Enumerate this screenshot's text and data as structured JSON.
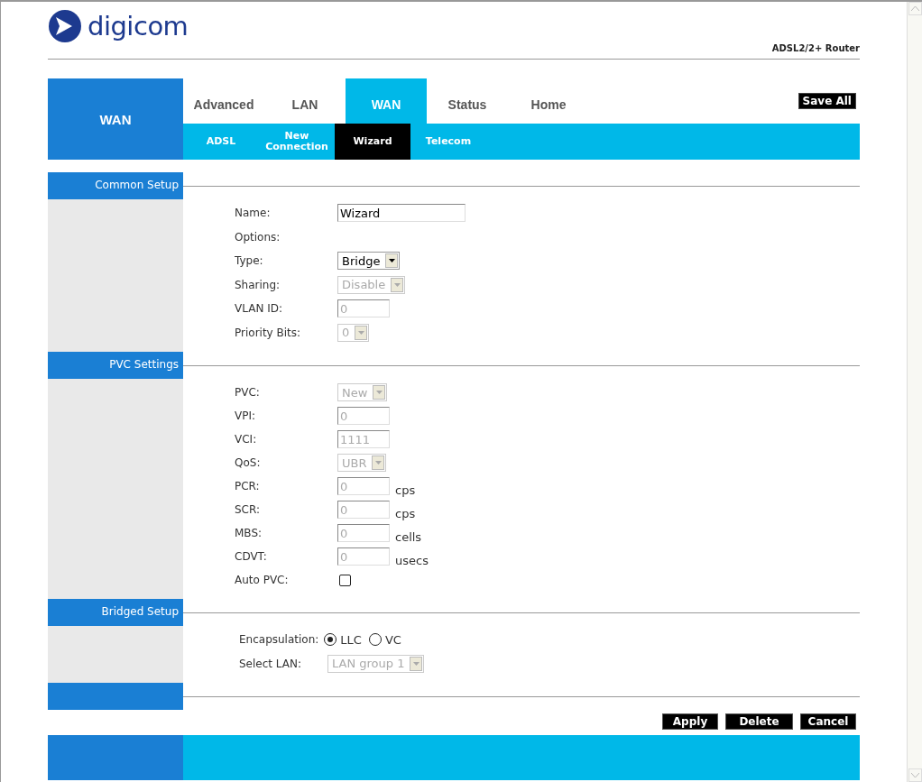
{
  "logo": {
    "text": "digicom"
  },
  "product": "ADSL2/2+ Router",
  "side_title": "WAN",
  "main_tabs": [
    {
      "label": "Advanced",
      "selected": false
    },
    {
      "label": "LAN",
      "selected": false
    },
    {
      "label": "WAN",
      "selected": true
    },
    {
      "label": "Status",
      "selected": false
    },
    {
      "label": "Home",
      "selected": false
    }
  ],
  "save_all": "Save All",
  "sub_tabs": [
    {
      "label": "ADSL",
      "selected": false
    },
    {
      "label": "New Connection",
      "selected": false
    },
    {
      "label": "Wizard",
      "selected": true
    },
    {
      "label": "Telecom",
      "selected": false
    }
  ],
  "sections": [
    {
      "title": "Common Setup",
      "fields": [
        {
          "kind": "text",
          "label": "Name:",
          "value": "Wizard",
          "disabled": false
        },
        {
          "kind": "heading",
          "label": "Options:"
        },
        {
          "kind": "select",
          "label": "Type:",
          "value": "Bridge",
          "disabled": false
        },
        {
          "kind": "select",
          "label": "Sharing:",
          "value": "Disable",
          "disabled": true
        },
        {
          "kind": "text",
          "label": "VLAN ID:",
          "value": "0",
          "disabled": true
        },
        {
          "kind": "select",
          "label": "Priority Bits:",
          "value": "0",
          "disabled": true
        }
      ]
    },
    {
      "title": "PVC Settings",
      "fields": [
        {
          "kind": "select",
          "label": "PVC:",
          "value": "New",
          "disabled": true
        },
        {
          "kind": "text",
          "label": "VPI:",
          "value": "0",
          "disabled": true
        },
        {
          "kind": "text",
          "label": "VCI:",
          "value": "1111",
          "disabled": true
        },
        {
          "kind": "select",
          "label": "QoS:",
          "value": "UBR",
          "disabled": true
        },
        {
          "kind": "text",
          "label": "PCR:",
          "value": "0",
          "disabled": true,
          "unit": "cps"
        },
        {
          "kind": "text",
          "label": "SCR:",
          "value": "0",
          "disabled": true,
          "unit": "cps"
        },
        {
          "kind": "text",
          "label": "MBS:",
          "value": "0",
          "disabled": true,
          "unit": "cells"
        },
        {
          "kind": "text",
          "label": "CDVT:",
          "value": "0",
          "disabled": true,
          "unit": "usecs"
        },
        {
          "kind": "checkbox",
          "label": "Auto PVC:",
          "checked": false
        }
      ]
    },
    {
      "title": "Bridged Setup",
      "fields": [
        {
          "kind": "radio",
          "label": "Encapsulation:",
          "options": [
            {
              "label": "LLC",
              "selected": true
            },
            {
              "label": "VC",
              "selected": false
            }
          ]
        },
        {
          "kind": "select",
          "label": "Select LAN:",
          "value": "LAN group 1",
          "disabled": true
        }
      ]
    }
  ],
  "buttons": [
    "Apply",
    "Delete",
    "Cancel"
  ]
}
